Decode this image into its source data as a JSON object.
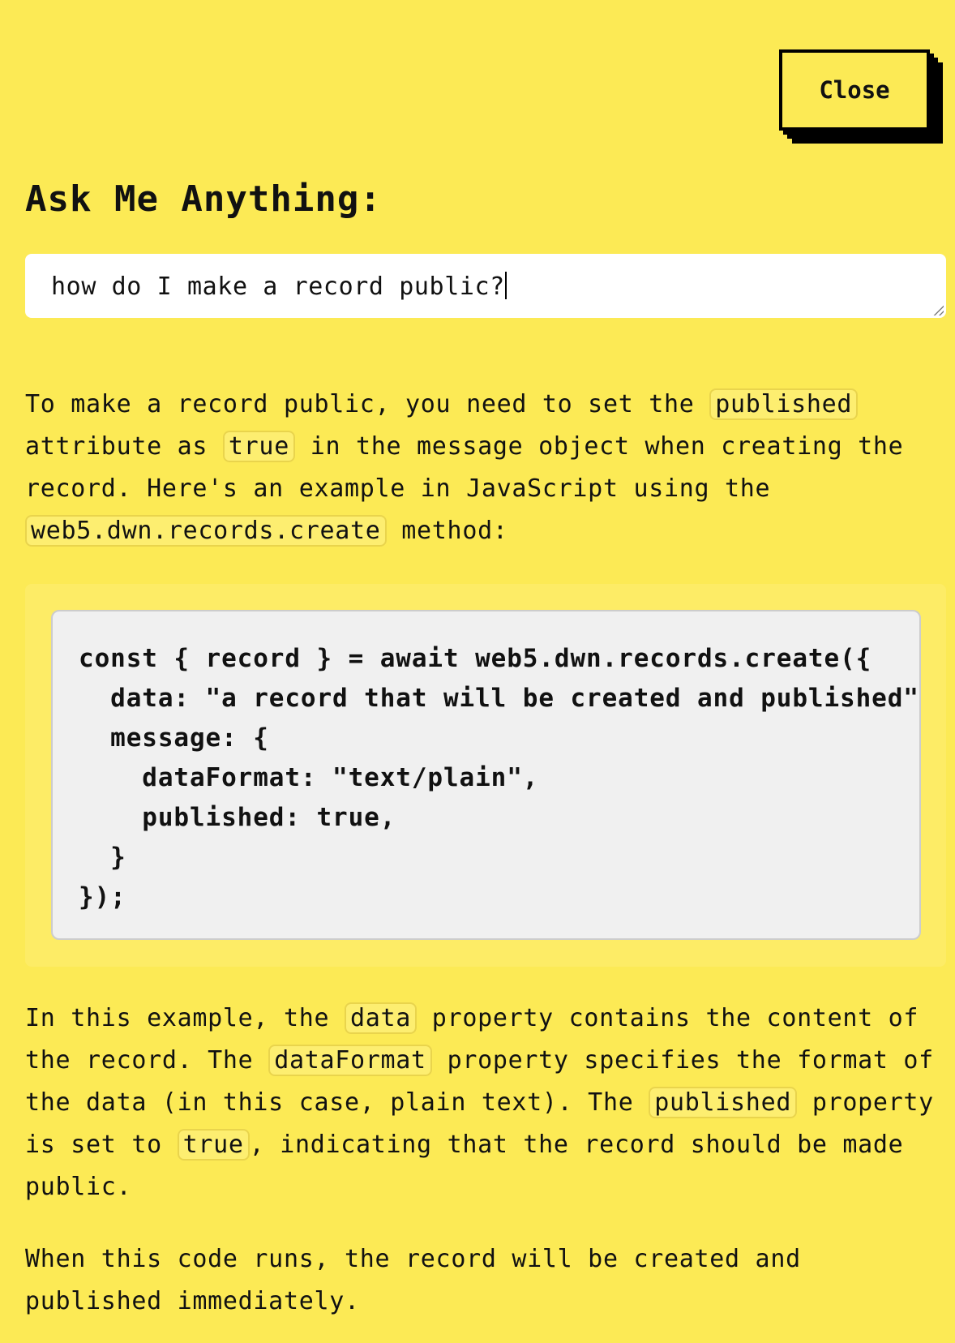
{
  "close_label": "Close",
  "heading": "Ask Me Anything:",
  "question": "how do I make a record public?",
  "answer": {
    "p1": [
      "To make a record public, you need to set the ",
      "published",
      " attribute as ",
      "true",
      " in the message object when creating the record. Here's an example in JavaScript using the ",
      "web5.dwn.records.create",
      " method:"
    ],
    "code": "const { record } = await web5.dwn.records.create({\n  data: \"a record that will be created and published\",\n  message: {\n    dataFormat: \"text/plain\",\n    published: true,\n  }\n});",
    "p2": [
      "In this example, the ",
      "data",
      " property contains the content of the record. The ",
      "dataFormat",
      " property specifies the format of the data (in this case, plain text). The ",
      "published",
      " property is set to ",
      "true",
      ", indicating that the record should be made public."
    ],
    "p3": "When this code runs, the record will be created and published immediately."
  },
  "colors": {
    "background": "#fcea55",
    "code_background": "#f0f0f0"
  }
}
